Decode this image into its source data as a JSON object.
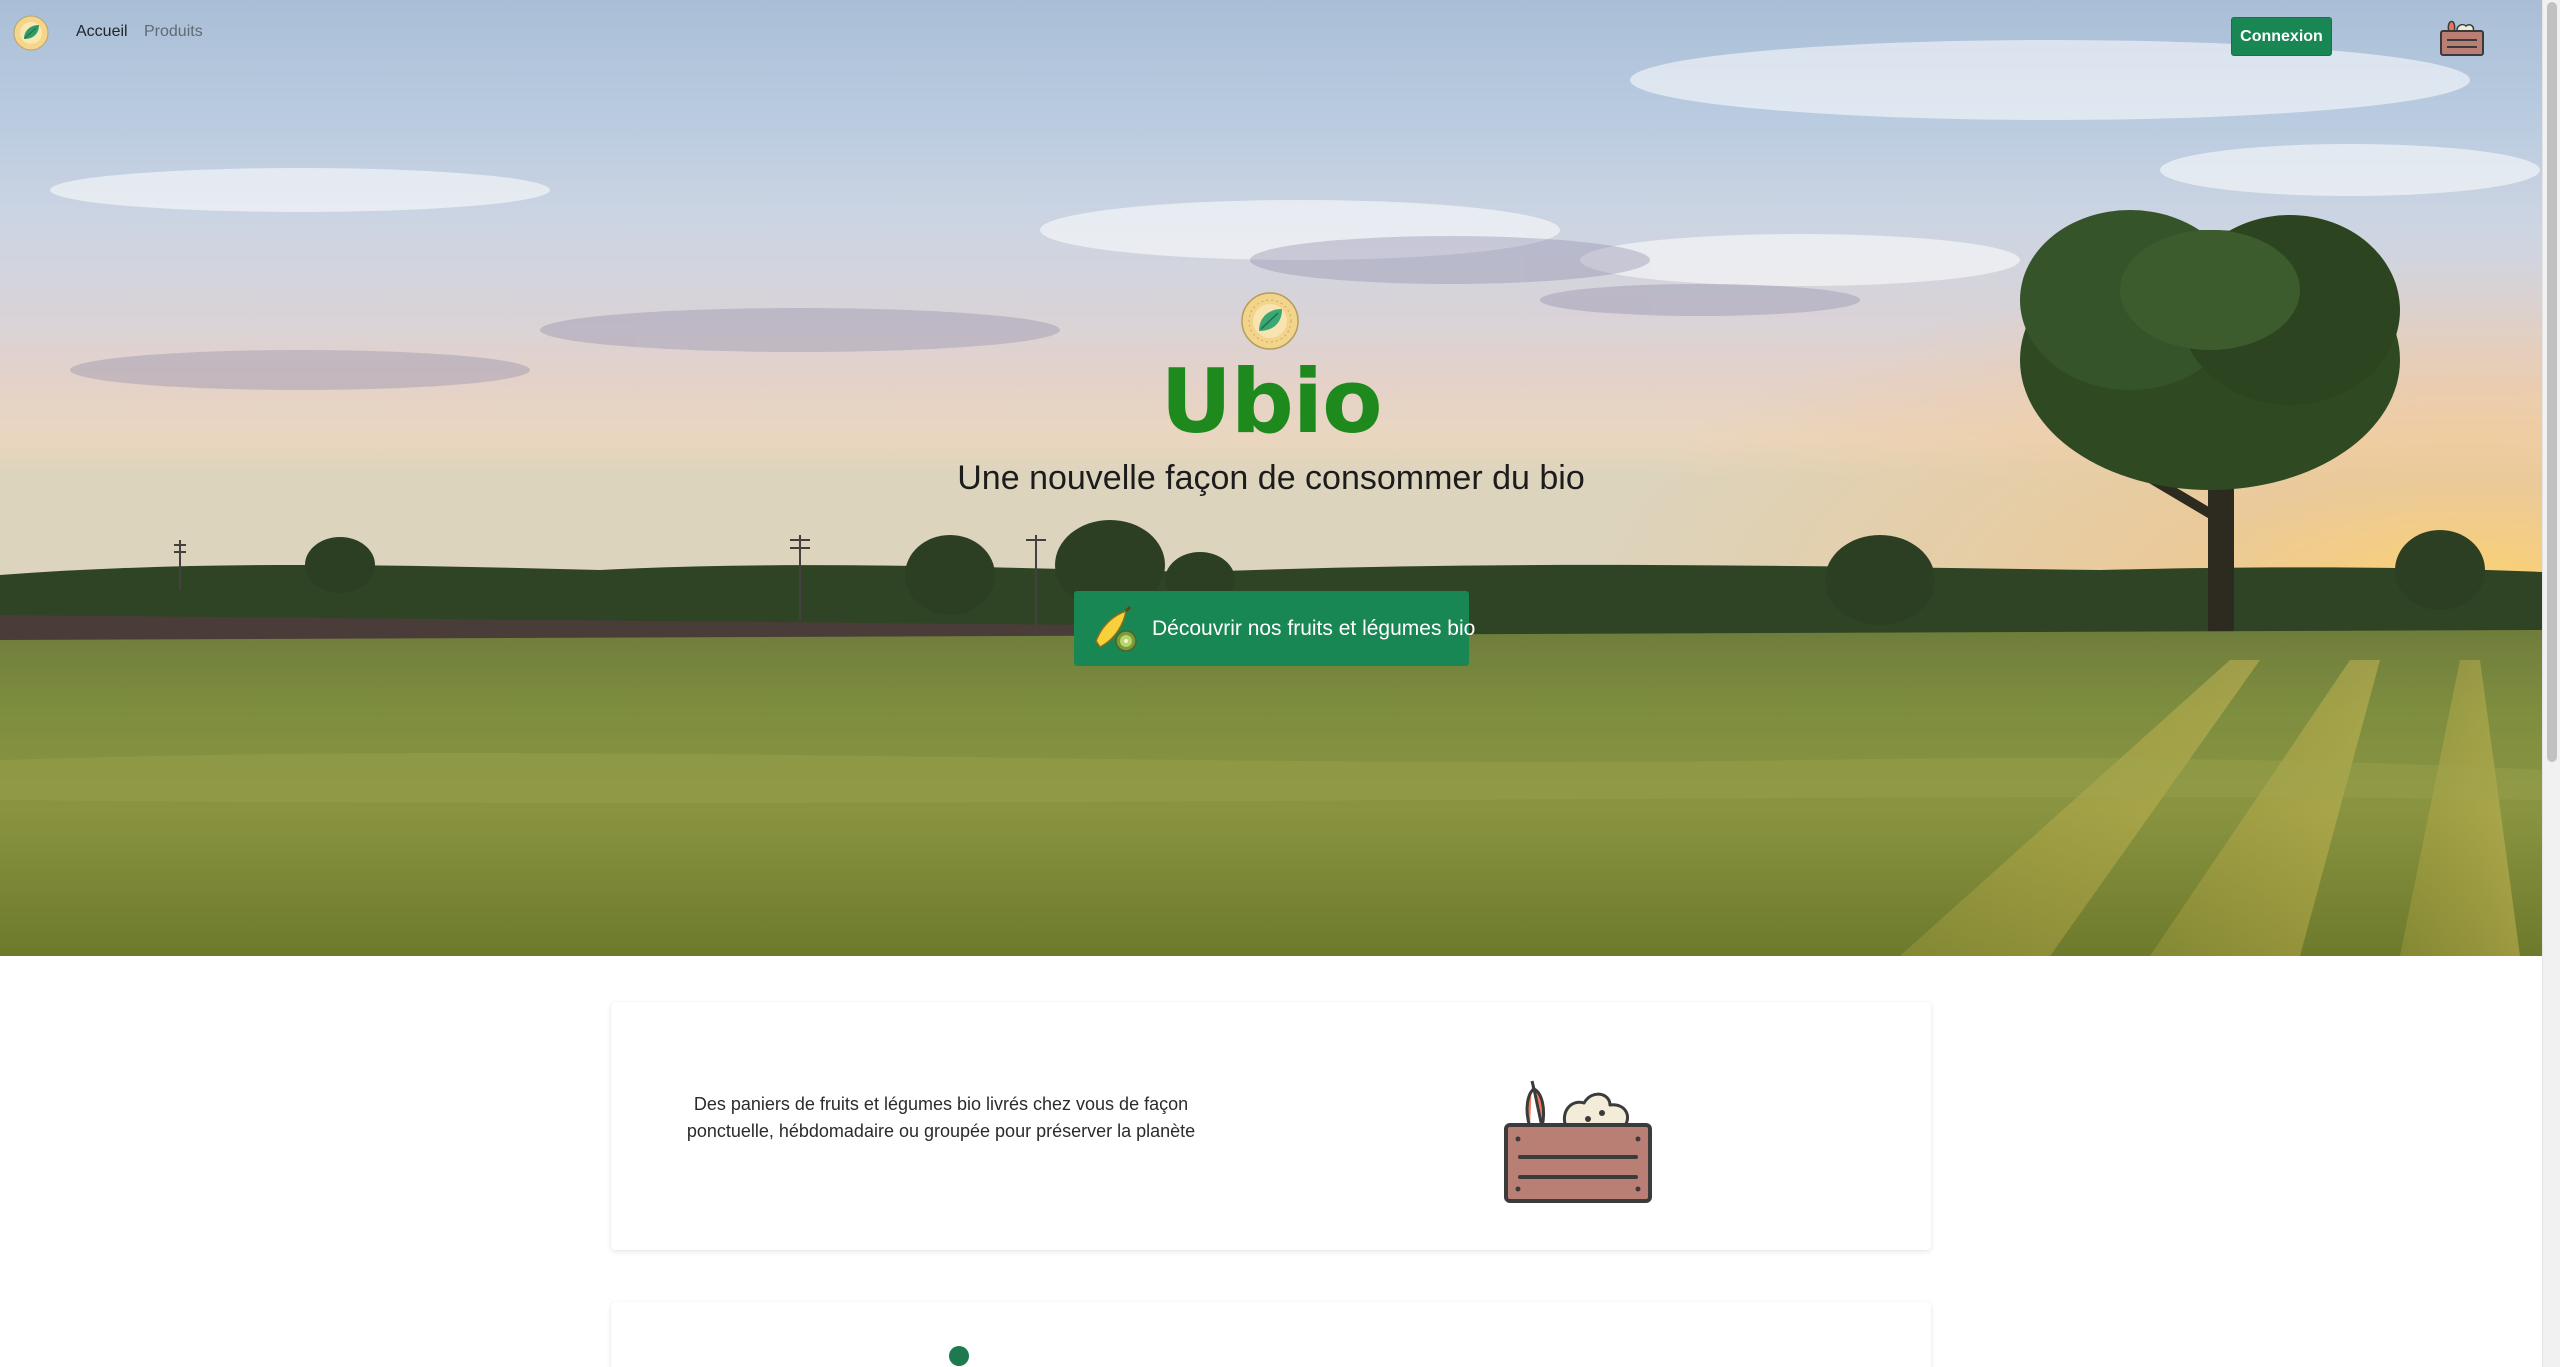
{
  "navbar": {
    "logo_icon": "ubio-leaf-logo-icon",
    "links": [
      {
        "label": "Accueil"
      },
      {
        "label": "Produits"
      }
    ],
    "login_label": "Connexion",
    "basket_icon": "vegetable-basket-icon"
  },
  "hero": {
    "background": "wheat-field-sunset-photo",
    "title": "Ubio",
    "subtitle": "Une nouvelle façon de consommer du bio",
    "cta_label": "Découvrir nos fruits et légumes bio",
    "cta_icon": "banana-kiwi-icon"
  },
  "features": [
    {
      "text": "Des paniers de fruits et légumes bio livrés chez vous de façon ponctuelle, hébdomadaire ou groupée pour préserver la planète",
      "illustration": "vegetable-crate-icon"
    },
    {
      "illustration": "green-sprout-icon"
    }
  ],
  "colors": {
    "brand_green": "#198754",
    "title_green": "#1e8a1e",
    "basket_brown": "#b97f75"
  }
}
